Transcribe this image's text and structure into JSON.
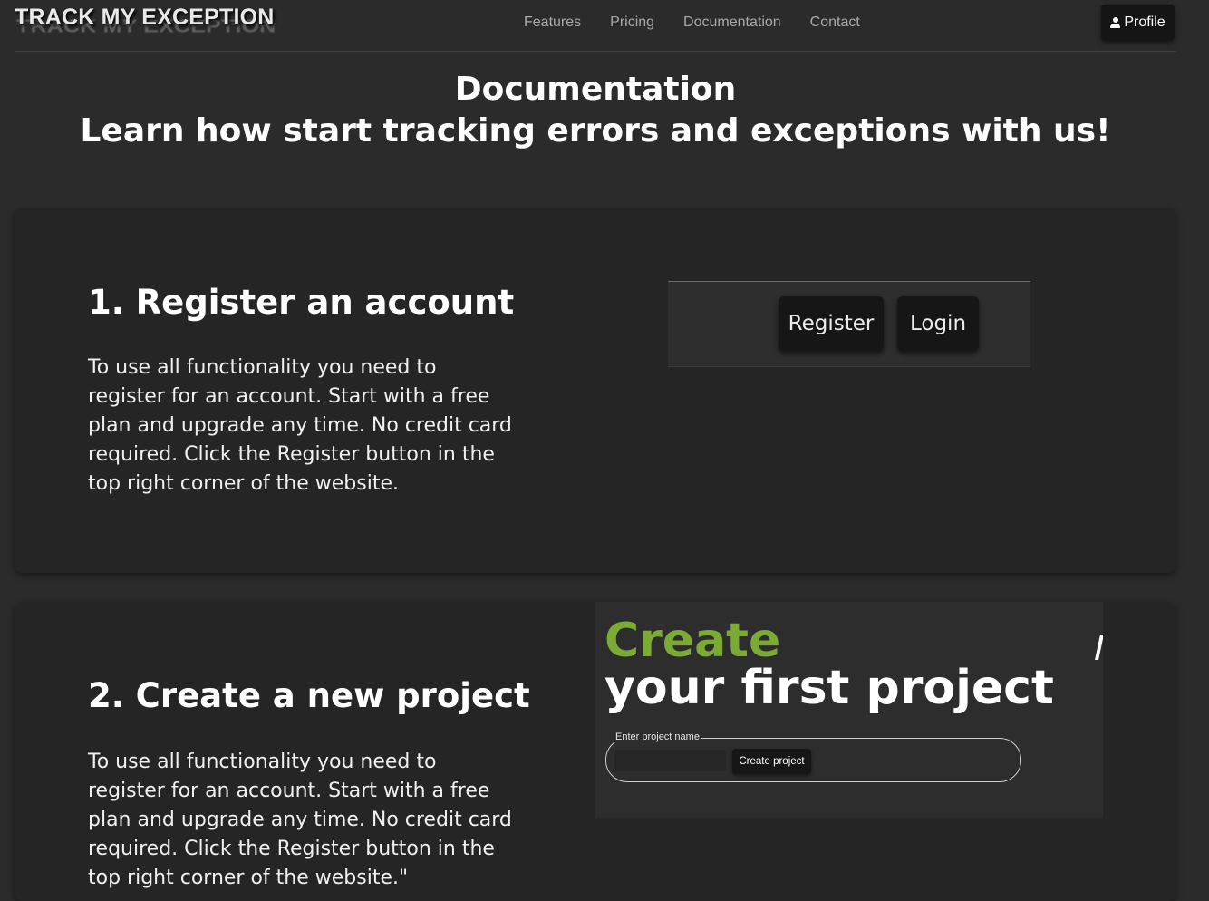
{
  "header": {
    "brand": "TRACK MY EXCEPTION",
    "nav": [
      "Features",
      "Pricing",
      "Documentation",
      "Contact"
    ],
    "profile_label": "Profile",
    "profile_icon": "person-icon"
  },
  "page": {
    "title": "Documentation",
    "subtitle": "Learn how start tracking errors and exceptions with us!"
  },
  "steps": [
    {
      "title": "1. Register an account",
      "text": "To use all functionality you need to register for an account. Start with a free plan and upgrade any time. No credit card required. Click the Register button in the top right corner of the website.",
      "image": {
        "register_label": "Register",
        "login_label": "Login"
      }
    },
    {
      "title": "2. Create a new project",
      "text": "To use all functionality you need to register for an account. Start with a free plan and upgrade any time. No credit card required. Click the Register button in the top right corner of the website.\"",
      "image": {
        "heading_accent": "Create",
        "heading_rest": "your first project",
        "field_label": "Enter project name",
        "button_label": "Create project"
      }
    }
  ],
  "colors": {
    "background": "#2b2b2b",
    "card": "#252525",
    "accent_green": "#7cab35",
    "nav_text": "#a9a9a9"
  }
}
